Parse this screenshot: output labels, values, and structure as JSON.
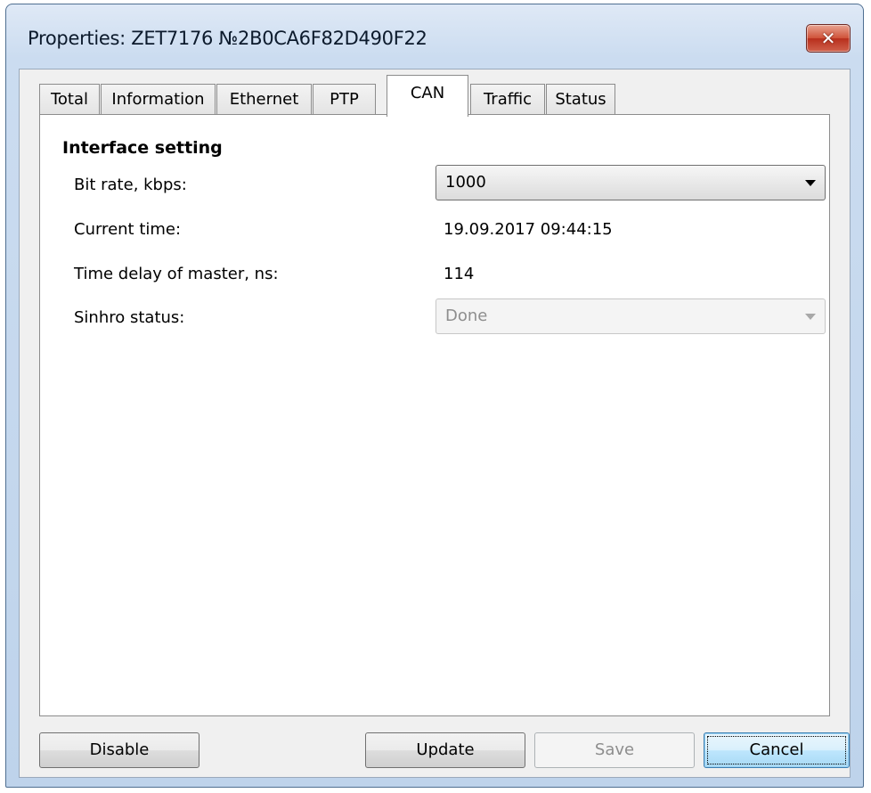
{
  "window": {
    "title": "Properties: ZET7176 №2B0CA6F82D490F22",
    "close_glyph": "✕"
  },
  "tabs": [
    {
      "label": "Total",
      "active": false
    },
    {
      "label": "Information",
      "active": false
    },
    {
      "label": "Ethernet",
      "active": false
    },
    {
      "label": "PTP",
      "active": false
    },
    {
      "label": "CAN",
      "active": true
    },
    {
      "label": "Traffic",
      "active": false
    },
    {
      "label": "Status",
      "active": false
    }
  ],
  "panel": {
    "group_title": "Interface setting",
    "bit_rate": {
      "label": "Bit rate, kbps:",
      "value": "1000"
    },
    "current_time": {
      "label": "Current time:",
      "value": "19.09.2017 09:44:15"
    },
    "time_delay": {
      "label": "Time delay of master, ns:",
      "value": "114"
    },
    "sinhro_status": {
      "label": "Sinhro status:",
      "value": "Done",
      "disabled": true
    }
  },
  "buttons": {
    "disable": "Disable",
    "update": "Update",
    "save": "Save",
    "cancel": "Cancel"
  },
  "colors": {
    "title_bar": "#cbdcf0",
    "close_button": "#cf5238",
    "default_button": "#bee6fd"
  }
}
